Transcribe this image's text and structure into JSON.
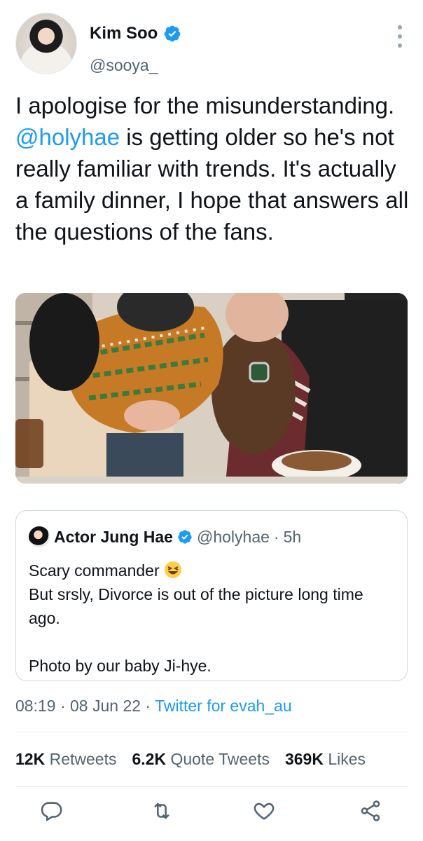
{
  "author": {
    "name": "Kim Soo",
    "handle": "@sooya_"
  },
  "tweet": {
    "text_before": "I apologise for the misunderstanding. ",
    "mention": "@holyhae",
    "text_after": " is getting older so he's not really familiar with trends. It's actually a family dinner, I hope that answers all the questions of the fans."
  },
  "quote": {
    "name": "Actor Jung Hae",
    "handle": "@holyhae",
    "sep": " · ",
    "time": "5h",
    "line1": "Scary commander",
    "line2": "But srsly, Divorce is out of the picture long time ago.",
    "line3": "Photo by our baby Ji-hye."
  },
  "meta": {
    "time": "08:19",
    "date": "08 Jun 22",
    "source": "Twitter for evah_au",
    "sep": " · "
  },
  "stats": {
    "retweets_count": "12K",
    "retweets_label": "Retweets",
    "quotes_count": "6.2K",
    "quotes_label": "Quote Tweets",
    "likes_count": "369K",
    "likes_label": "Likes"
  },
  "icons": [
    "verified-badge-icon",
    "more-options-icon",
    "reply-icon",
    "retweet-icon",
    "like-icon",
    "share-icon"
  ],
  "colors": {
    "accent": "#1d9bf0",
    "secondary_text": "#536471",
    "text": "#0f1419"
  }
}
